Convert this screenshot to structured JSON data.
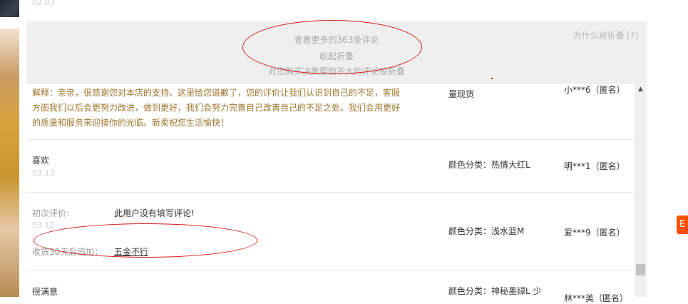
{
  "top": {
    "date": "02.03"
  },
  "fold": {
    "more": "查看更多的363条评论",
    "collapse": "收起折叠",
    "note": "对您购买决策帮助不大的评论被折叠",
    "why": "为什么被折叠 [?]"
  },
  "reviews": [
    {
      "reply": "解释：亲亲，很感谢您对本店的支持。这里给您道歉了，您的评价让我们认识到自己的不足，客服方面我们以后会更努力改进，做到更好，我们会努力完善自己改善自己的不足之处。我们会用更好的质量和服务来迎接你的光临。新柔祝您生活愉快！",
      "sku": "量现货",
      "user": "小***6（匿名）"
    },
    {
      "text": "喜欢",
      "date": "03.13",
      "sku": "颜色分类：热情大红L",
      "user": "明***1（匿名）"
    },
    {
      "initial_label": "初次评价:",
      "initial_text": "此用户没有填写评论!",
      "date": "03.12",
      "append_label": "收货30天后追加：",
      "append_text": "五金不行",
      "sku": "颜色分类：浅水蓝M",
      "user": "爱***9（匿名）"
    },
    {
      "text": "很满意",
      "sku": "颜色分类：神秘墨绿L 少",
      "user": "林***美（匿名）"
    }
  ],
  "side": {
    "badge": "E"
  }
}
